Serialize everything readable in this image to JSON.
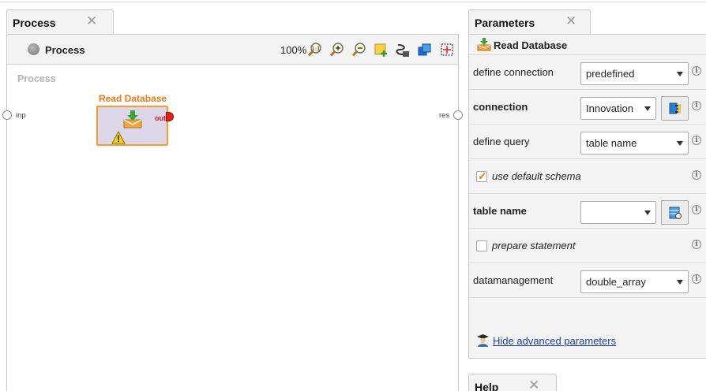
{
  "process_panel": {
    "tab_label": "Process",
    "breadcrumb": "Process",
    "zoom_level": "100%",
    "canvas_label": "Process",
    "input_port_label": "inp",
    "result_port_label": "res",
    "operator": {
      "name": "Read Database",
      "output_port_label": "out",
      "status": "warning"
    }
  },
  "parameters_panel": {
    "tab_label": "Parameters",
    "operator_name": "Read Database",
    "params": [
      {
        "label": "define connection",
        "value": "predefined"
      },
      {
        "label": "connection",
        "value": "Innovation"
      },
      {
        "label": "define query",
        "value": "table name"
      },
      {
        "label": "use default schema",
        "checked": true
      },
      {
        "label": "table name",
        "value": ""
      },
      {
        "label": "prepare statement",
        "checked": false
      },
      {
        "label": "datamanagement",
        "value": "double_array"
      }
    ],
    "hide_advanced_link": "Hide advanced parameters"
  },
  "help_panel": {
    "tab_label": "Help"
  },
  "colors": {
    "accent_orange": "#f07a18",
    "operator_fill": "#dcd7e8",
    "output_port": "#e2231a",
    "link_blue": "#1a3ea6"
  }
}
